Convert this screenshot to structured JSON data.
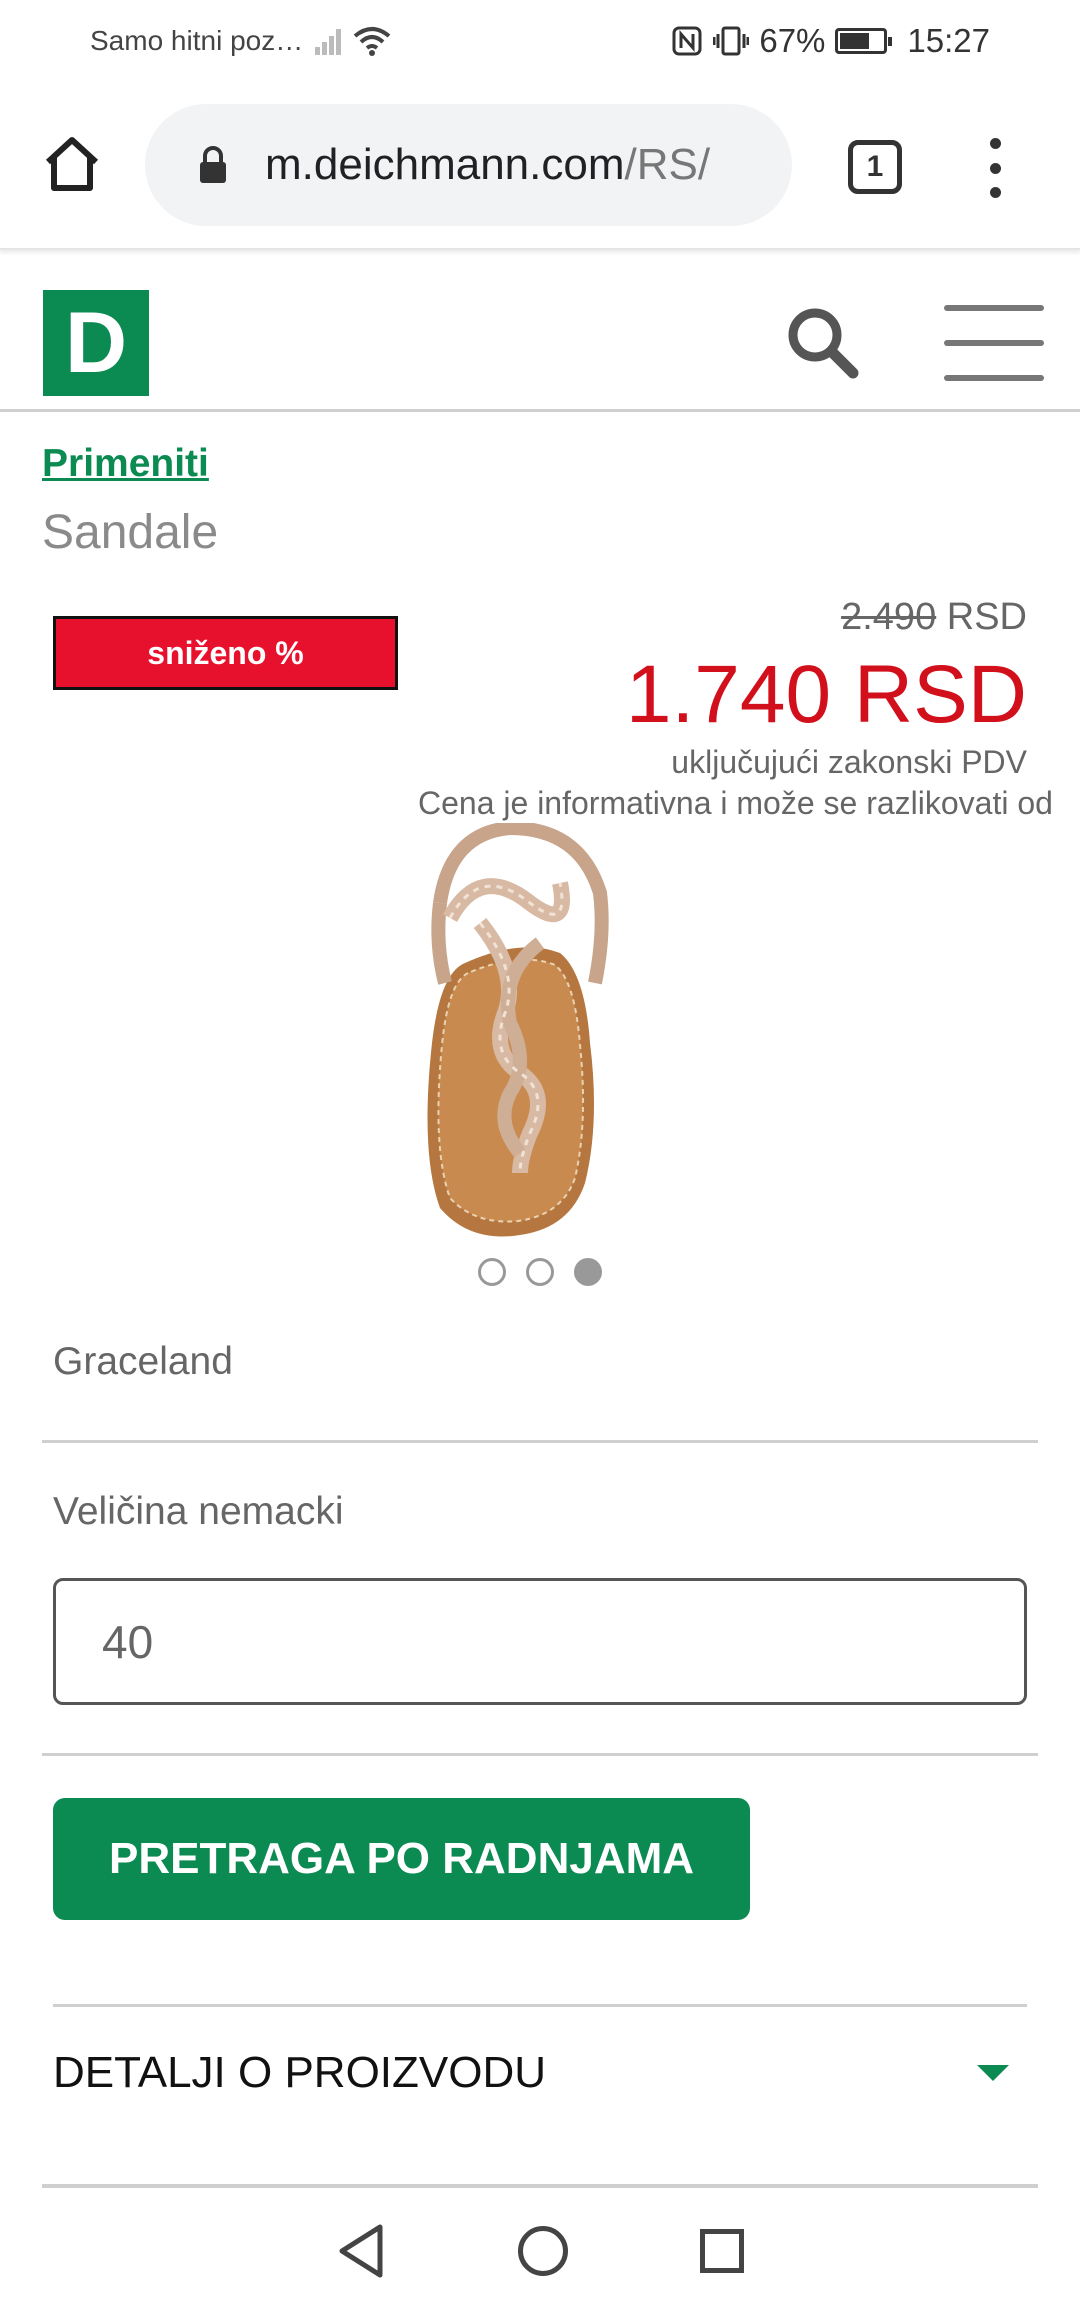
{
  "status_bar": {
    "carrier": "Samo hitni poz…",
    "battery": "67%",
    "battery_level": 0.67,
    "time": "15:27"
  },
  "browser": {
    "url_domain": "m.deichmann.com",
    "url_path": "/RS/",
    "tab_count": "1"
  },
  "site": {
    "logo_letter": "D",
    "brand_color": "#0b8a52"
  },
  "product": {
    "brand_link": "Primeniti",
    "category": "Sandale",
    "sale_badge": "sniženo %",
    "old_price": "2.490",
    "old_price_currency": " RSD",
    "new_price": "1.740 RSD",
    "price_color": "#d2101c",
    "vat_note": "uključujući zakonski PDV",
    "disclaimer": "Cena je informativna i može se razlikovati od",
    "brand_name": "Graceland",
    "size_label": "Veličina nemacki",
    "size_value": "40",
    "store_search_button": "PRETRAGA PO RADNJAMA",
    "details_label": "DETALJI O PROIZVODU",
    "carousel": {
      "total": 3,
      "active": 3
    }
  }
}
